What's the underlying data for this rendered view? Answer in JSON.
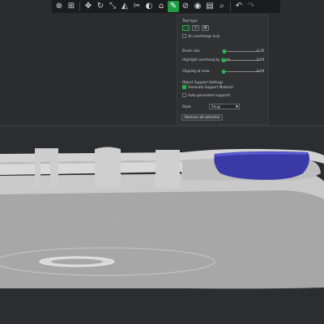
{
  "toolbar": {
    "buttons": [
      {
        "name": "add-object-icon",
        "glyph": "⊕"
      },
      {
        "name": "arrange-icon",
        "glyph": "⊞"
      },
      {
        "name": "move-icon",
        "glyph": "✥"
      },
      {
        "name": "rotate-icon",
        "glyph": "↻"
      },
      {
        "name": "scale-icon",
        "glyph": "⤡"
      },
      {
        "name": "place-on-face-icon",
        "glyph": "◭"
      },
      {
        "name": "cut-icon",
        "glyph": "✂"
      },
      {
        "name": "hollow-icon",
        "glyph": "◐"
      },
      {
        "name": "sla-support-points-icon",
        "glyph": "⌂"
      },
      {
        "name": "fdm-supports-paint-icon",
        "glyph": "✎"
      },
      {
        "name": "seam-paint-icon",
        "glyph": "⊘"
      },
      {
        "name": "mmu-paint-icon",
        "glyph": "◉"
      },
      {
        "name": "variable-layer-height-icon",
        "glyph": "▤"
      },
      {
        "name": "search-icon",
        "glyph": "⌕"
      }
    ],
    "undo_glyph": "↶",
    "redo_glyph": "↷"
  },
  "panel": {
    "tool_type_label": "Tool type",
    "on_overhangs_only_label": "On overhangs only",
    "brush_size": {
      "label": "Brush size",
      "value": "0.30",
      "fraction": 0.05
    },
    "highlight_overhang": {
      "label": "Highlight overhang by angle",
      "value": "0.00",
      "fraction": 0.04
    },
    "clipping_of_view": {
      "label": "Clipping of view",
      "value": "0.00",
      "fraction": 0.04
    },
    "object_support_settings_label": "Object Support Settings",
    "generate_support_material": {
      "label": "Generate Support Material",
      "checked": true
    },
    "auto_generated_supports": {
      "label": "Auto generated supports",
      "checked": false
    },
    "style_label": "Style",
    "style_value": "Snug",
    "remove_all_button": "Remove all selection"
  },
  "colors": {
    "accent": "#27b24c",
    "background": "#2b2c2e",
    "model": "#cfcfcf",
    "support_paint": "#3c3ca8"
  }
}
